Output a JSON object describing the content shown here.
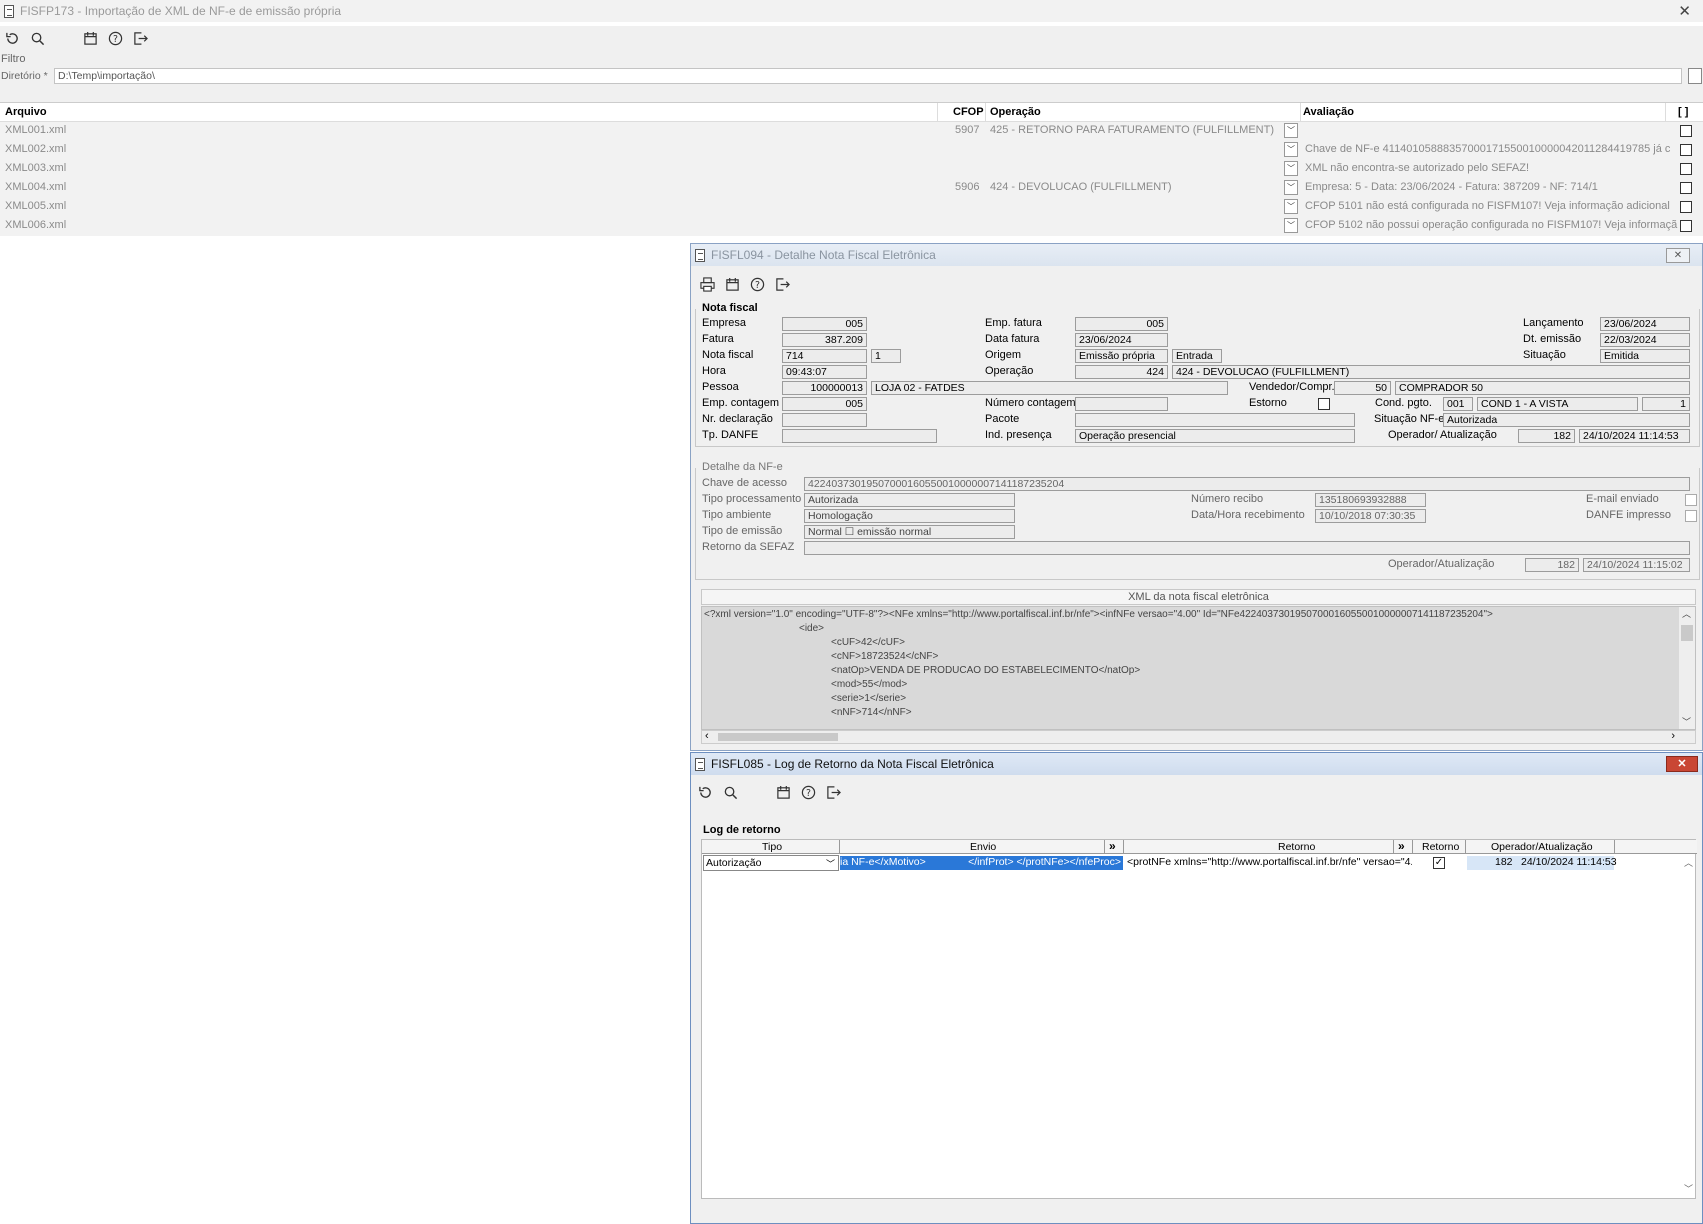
{
  "main": {
    "title": "FISFP173 - Importação de XML de NF-e de emissão própria",
    "filter_label": "Filtro",
    "dir_label": "Diretório *",
    "dir_value": "D:\\Temp\\importação\\",
    "columns": {
      "arquivo": "Arquivo",
      "cfop": "CFOP",
      "operacao": "Operação",
      "avaliacao": "Avaliação",
      "select": "[ ]"
    },
    "rows": [
      {
        "arquivo": "XML001.xml",
        "cfop": "5907",
        "operacao": "425 - RETORNO PARA FATURAMENTO (FULFILLMENT)",
        "avaliacao": ""
      },
      {
        "arquivo": "XML002.xml",
        "cfop": "",
        "operacao": "",
        "avaliacao": "Chave de NF-e 41140105888357000171550010000042011284419785 já c"
      },
      {
        "arquivo": "XML003.xml",
        "cfop": "",
        "operacao": "",
        "avaliacao": "XML não encontra-se autorizado pelo SEFAZ!"
      },
      {
        "arquivo": "XML004.xml",
        "cfop": "5906",
        "operacao": "424 - DEVOLUCAO (FULFILLMENT)",
        "avaliacao": "Empresa: 5 - Data: 23/06/2024 - Fatura: 387209 - NF: 714/1"
      },
      {
        "arquivo": "XML005.xml",
        "cfop": "",
        "operacao": "",
        "avaliacao": "CFOP 5101 não está configurada no FISFM107! Veja informação adicional"
      },
      {
        "arquivo": "XML006.xml",
        "cfop": "",
        "operacao": "",
        "avaliacao": "CFOP 5102 não possui operação configurada no FISFM107! Veja informaçã"
      }
    ]
  },
  "detail": {
    "title": "FISFL094 - Detalhe Nota Fiscal Eletrônica",
    "nf_section": "Nota fiscal",
    "labels": {
      "empresa": "Empresa",
      "fatura": "Fatura",
      "nota": "Nota fiscal",
      "hora": "Hora",
      "pessoa": "Pessoa",
      "emp_contagem": "Emp. contagem",
      "nr_decl": "Nr. declaração",
      "tp_danfe": "Tp. DANFE",
      "emp_fatura": "Emp. fatura",
      "data_fatura": "Data fatura",
      "origem": "Origem",
      "operacao": "Operação",
      "vendedor": "Vendedor/Compr.",
      "num_contagem": "Número contagem",
      "estorno": "Estorno",
      "cond_pgto": "Cond. pgto.",
      "pacote": "Pacote",
      "situacao_nfe": "Situação NF-e",
      "ind_presenca": "Ind. presença",
      "operador": "Operador/ Atualização",
      "lancamento": "Lançamento",
      "dt_emissao": "Dt. emissão",
      "situacao": "Situação"
    },
    "values": {
      "empresa": "005",
      "fatura": "387.209",
      "nota": "714",
      "serie": "1",
      "hora": "09:43:07",
      "pessoa_cod": "100000013",
      "pessoa_nome": "LOJA 02 - FATDES",
      "emp_contagem": "005",
      "emp_fatura": "005",
      "data_fatura": "23/06/2024",
      "origem": "Emissão própria",
      "origem2": "Entrada",
      "operacao_cod": "424",
      "operacao_desc": "424 - DEVOLUCAO (FULFILLMENT)",
      "vendedor_cod": "50",
      "vendedor_nome": "COMPRADOR 50",
      "cond_cod": "001",
      "cond_desc": "COND 1 - A VISTA",
      "cond_n": "1",
      "situacao_nfe": "Autorizada",
      "ind_presenca": "Operação presencial",
      "operador": "182",
      "atualizacao": "24/10/2024 11:14:53",
      "lancamento": "23/06/2024",
      "dt_emissao": "22/03/2024",
      "situacao": "Emitida"
    },
    "nfe_section": "Detalhe da NF-e",
    "nfe_labels": {
      "chave": "Chave de acesso",
      "tipo_proc": "Tipo processamento",
      "tipo_amb": "Tipo ambiente",
      "tipo_emissao": "Tipo de emissão",
      "retorno": "Retorno da SEFAZ",
      "num_recibo": "Número recibo",
      "data_receb": "Data/Hora recebimento",
      "email": "E-mail enviado",
      "danfe": "DANFE impresso",
      "operador": "Operador/Atualização"
    },
    "nfe_values": {
      "chave": "42240373019507000160550010000007141187235204",
      "tipo_proc": "Autorizada",
      "tipo_amb": "Homologação",
      "tipo_emissao": "Normal ☐ emissão normal",
      "num_recibo": "135180693932888",
      "data_receb": "10/10/2018 07:30:35",
      "operador": "182",
      "atualizacao": "24/10/2024 11:15:02"
    },
    "xml_title": "XML da nota fiscal eletrônica",
    "xml_lines": [
      "<?xml version=\"1.0\" encoding=\"UTF-8\"?><NFe xmlns=\"http://www.portalfiscal.inf.br/nfe\"><infNFe versao=\"4.00\" Id=\"NFe42240373019507000160550010000007141187235204\">",
      "<ide>",
      "<cUF>42</cUF>",
      "<cNF>18723524</cNF>",
      "<natOp>VENDA DE PRODUCAO DO ESTABELECIMENTO</natOp>",
      "<mod>55</mod>",
      "<serie>1</serie>",
      "<nNF>714</nNF>"
    ]
  },
  "log": {
    "title": "FISFL085 - Log de Retorno da Nota Fiscal Eletrônica",
    "section": "Log de retorno",
    "columns": {
      "tipo": "Tipo",
      "envio": "Envio",
      "retorno": "Retorno",
      "retorno_chk": "Retorno",
      "operador": "Operador/Atualização",
      "expand": "»"
    },
    "row": {
      "tipo": "Autorização",
      "envio_a": "ia NF-e</xMotivo>",
      "envio_b": "</infProt> </protNFe></nfeProc>",
      "retorno": "<protNFe xmlns=\"http://www.portalfiscal.inf.br/nfe\" versao=\"4.0",
      "operador": "182",
      "atualizacao": "24/10/2024 11:14:53"
    }
  }
}
